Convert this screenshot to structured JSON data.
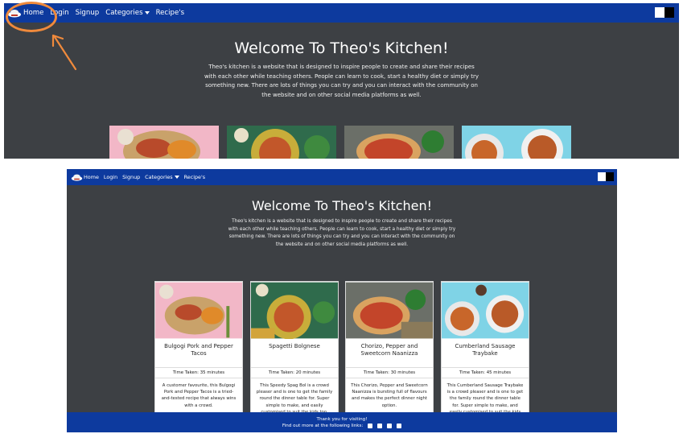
{
  "nav": {
    "items": [
      {
        "label": "Home"
      },
      {
        "label": "Login"
      },
      {
        "label": "Signup"
      },
      {
        "label": "Categories"
      },
      {
        "label": "Recipe's"
      }
    ],
    "logo_icon": "chef-hat-logo-icon",
    "theme_toggle": "light-dark-toggle"
  },
  "hero": {
    "title": "Welcome To Theo's Kitchen!",
    "description": "Theo's kitchen is a website that is designed to inspire people to create and share their recipes with each other while teaching others. People can learn to cook, start a healthy diet or simply try something new. There are lots of things you can try and you can interact with the community on the website and on other social media platforms as well."
  },
  "recipes": [
    {
      "title": "Bulgogi Pork and Pepper Tacos",
      "time": "Time Taken: 35 minutes",
      "description": "A customer favourite, this Bulgogi Pork and Pepper Tacos is a tried-and-tested recipe that always wins with a crowd."
    },
    {
      "title": "Spagetti Bolgnese",
      "time": "Time Taken: 20 minutes",
      "description": "This Speedy Spag Bol is a crowd pleaser and is one to get the family round the dinner table for. Super simple to make, and easily customised to suit the kids too."
    },
    {
      "title": "Chorizo, Pepper and Sweetcorn Naanizza",
      "time": "Time Taken: 30 minutes",
      "description": "This Chorizo, Pepper and Sweetcorn Naanizza is bursting full of flavours and makes the perfect dinner night option."
    },
    {
      "title": "Cumberland Sausage Traybake",
      "time": "Time Taken: 45 minutes",
      "description": "This Cumberland Sausage Traybake is a crowd pleaser and is one to get the family round the dinner table for. Super simple to make, and easily customised to suit the kids too."
    }
  ],
  "footer": {
    "line1": "Thank you for visiting!",
    "line2": "Find out more at the following links:",
    "social_icons": [
      "facebook-icon",
      "twitter-icon",
      "instagram-icon",
      "youtube-icon"
    ]
  },
  "colors": {
    "nav": "#0d3a9e",
    "hero": "#3d4044",
    "highlight": "#f08a3c"
  }
}
